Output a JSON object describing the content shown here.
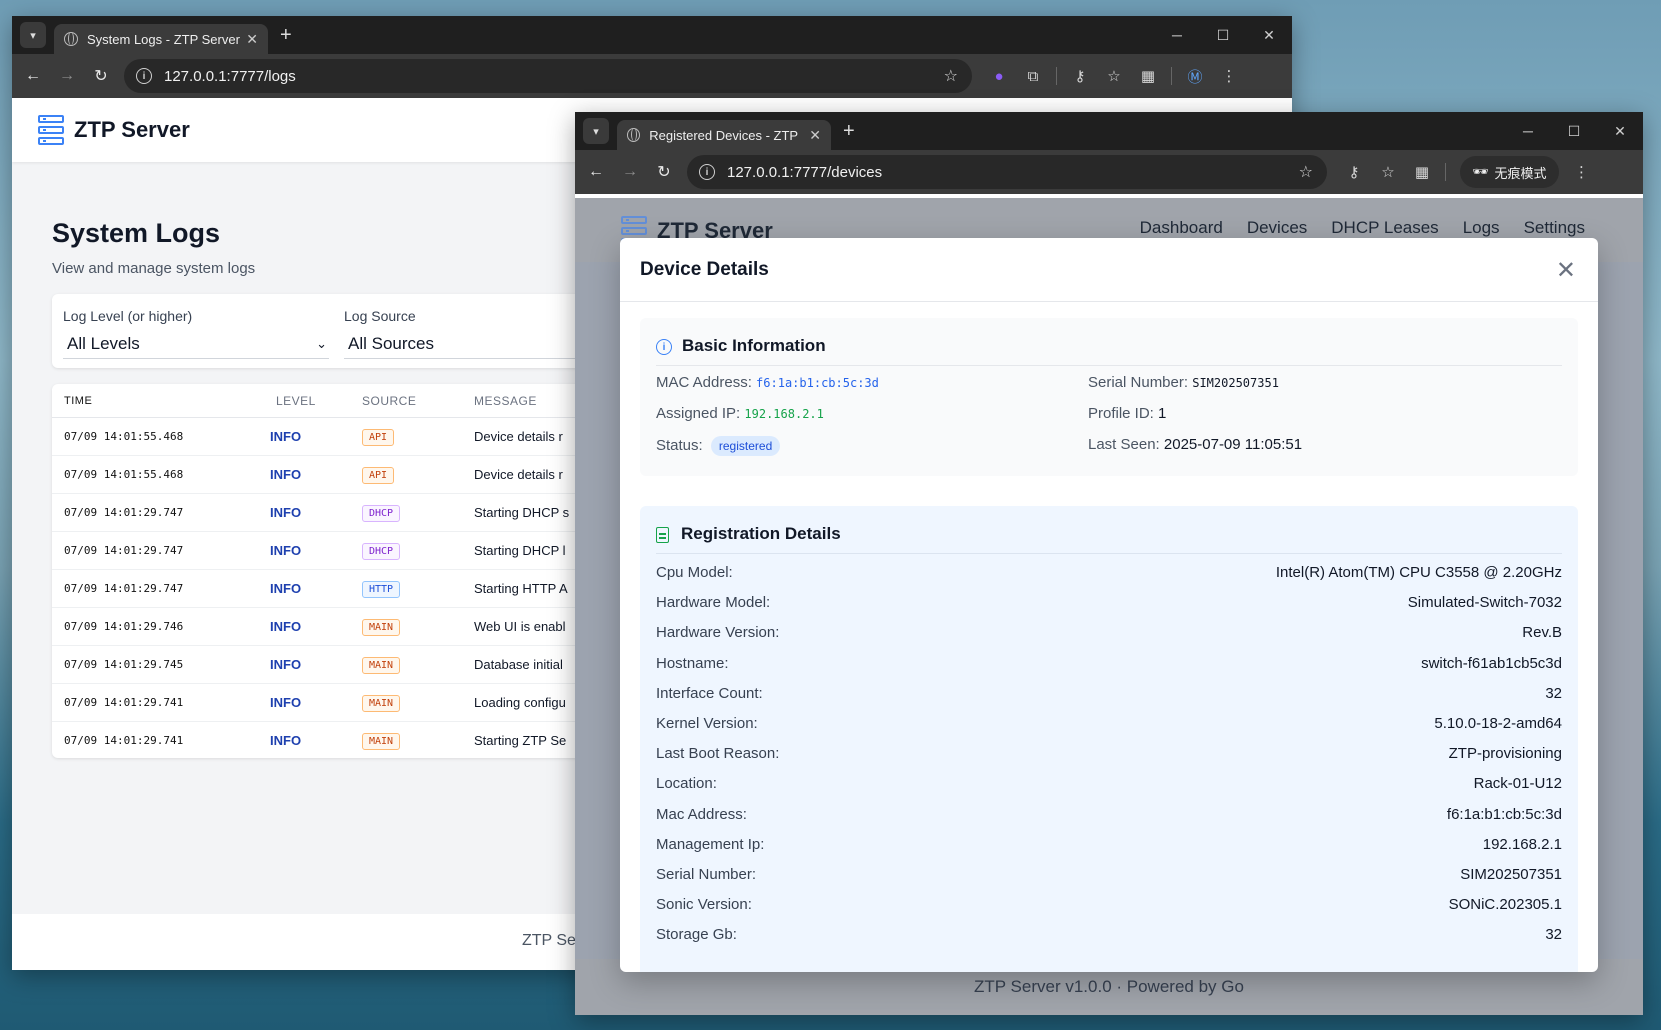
{
  "window1": {
    "tab_title": "System Logs - ZTP Server",
    "url": "127.0.0.1:7777/logs",
    "brand": "ZTP Server",
    "page_title": "System Logs",
    "page_subtitle": "View and manage system logs",
    "filters": {
      "level_label": "Log Level (or higher)",
      "level_value": "All Levels",
      "source_label": "Log Source",
      "source_value": "All Sources"
    },
    "table_headers": [
      "TIME",
      "LEVEL",
      "SOURCE",
      "MESSAGE"
    ],
    "rows": [
      {
        "time": "07/09 14:01:55.468",
        "level": "INFO",
        "source": "API",
        "message": "Device details r"
      },
      {
        "time": "07/09 14:01:55.468",
        "level": "INFO",
        "source": "API",
        "message": "Device details r"
      },
      {
        "time": "07/09 14:01:29.747",
        "level": "INFO",
        "source": "DHCP",
        "message": "Starting DHCP s"
      },
      {
        "time": "07/09 14:01:29.747",
        "level": "INFO",
        "source": "DHCP",
        "message": "Starting DHCP l"
      },
      {
        "time": "07/09 14:01:29.747",
        "level": "INFO",
        "source": "HTTP",
        "message": "Starting HTTP A"
      },
      {
        "time": "07/09 14:01:29.746",
        "level": "INFO",
        "source": "MAIN",
        "message": "Web UI is enabl"
      },
      {
        "time": "07/09 14:01:29.745",
        "level": "INFO",
        "source": "MAIN",
        "message": "Database initial"
      },
      {
        "time": "07/09 14:01:29.741",
        "level": "INFO",
        "source": "MAIN",
        "message": "Loading configu"
      },
      {
        "time": "07/09 14:01:29.741",
        "level": "INFO",
        "source": "MAIN",
        "message": "Starting ZTP Se"
      }
    ],
    "footer": "ZTP Se"
  },
  "window2": {
    "tab_title": "Registered Devices - ZTP Ser",
    "url": "127.0.0.1:7777/devices",
    "incognito_label": "无痕模式",
    "brand": "ZTP Server",
    "nav": [
      "Dashboard",
      "Devices",
      "DHCP Leases",
      "Logs",
      "Settings"
    ],
    "footer": "ZTP Server v1.0.0 · Powered by Go",
    "modal": {
      "title": "Device Details",
      "basic": {
        "heading": "Basic Information",
        "mac_label": "MAC Address:",
        "mac": "f6:1a:b1:cb:5c:3d",
        "ip_label": "Assigned IP:",
        "ip": "192.168.2.1",
        "status_label": "Status:",
        "status": "registered",
        "serial_label": "Serial Number:",
        "serial": "SIM202507351",
        "profile_label": "Profile ID:",
        "profile": "1",
        "seen_label": "Last Seen:",
        "seen": "2025-07-09 11:05:51"
      },
      "registration": {
        "heading": "Registration Details",
        "rows": [
          {
            "k": "Cpu Model:",
            "v": "Intel(R) Atom(TM) CPU C3558 @ 2.20GHz"
          },
          {
            "k": "Hardware Model:",
            "v": "Simulated-Switch-7032"
          },
          {
            "k": "Hardware Version:",
            "v": "Rev.B"
          },
          {
            "k": "Hostname:",
            "v": "switch-f61ab1cb5c3d"
          },
          {
            "k": "Interface Count:",
            "v": "32"
          },
          {
            "k": "Kernel Version:",
            "v": "5.10.0-18-2-amd64"
          },
          {
            "k": "Last Boot Reason:",
            "v": "ZTP-provisioning"
          },
          {
            "k": "Location:",
            "v": "Rack-01-U12"
          },
          {
            "k": "Mac Address:",
            "v": "f6:1a:b1:cb:5c:3d"
          },
          {
            "k": "Management Ip:",
            "v": "192.168.2.1"
          },
          {
            "k": "Serial Number:",
            "v": "SIM202507351"
          },
          {
            "k": "Sonic Version:",
            "v": "SONiC.202305.1"
          },
          {
            "k": "Storage Gb:",
            "v": "32"
          }
        ]
      }
    }
  }
}
